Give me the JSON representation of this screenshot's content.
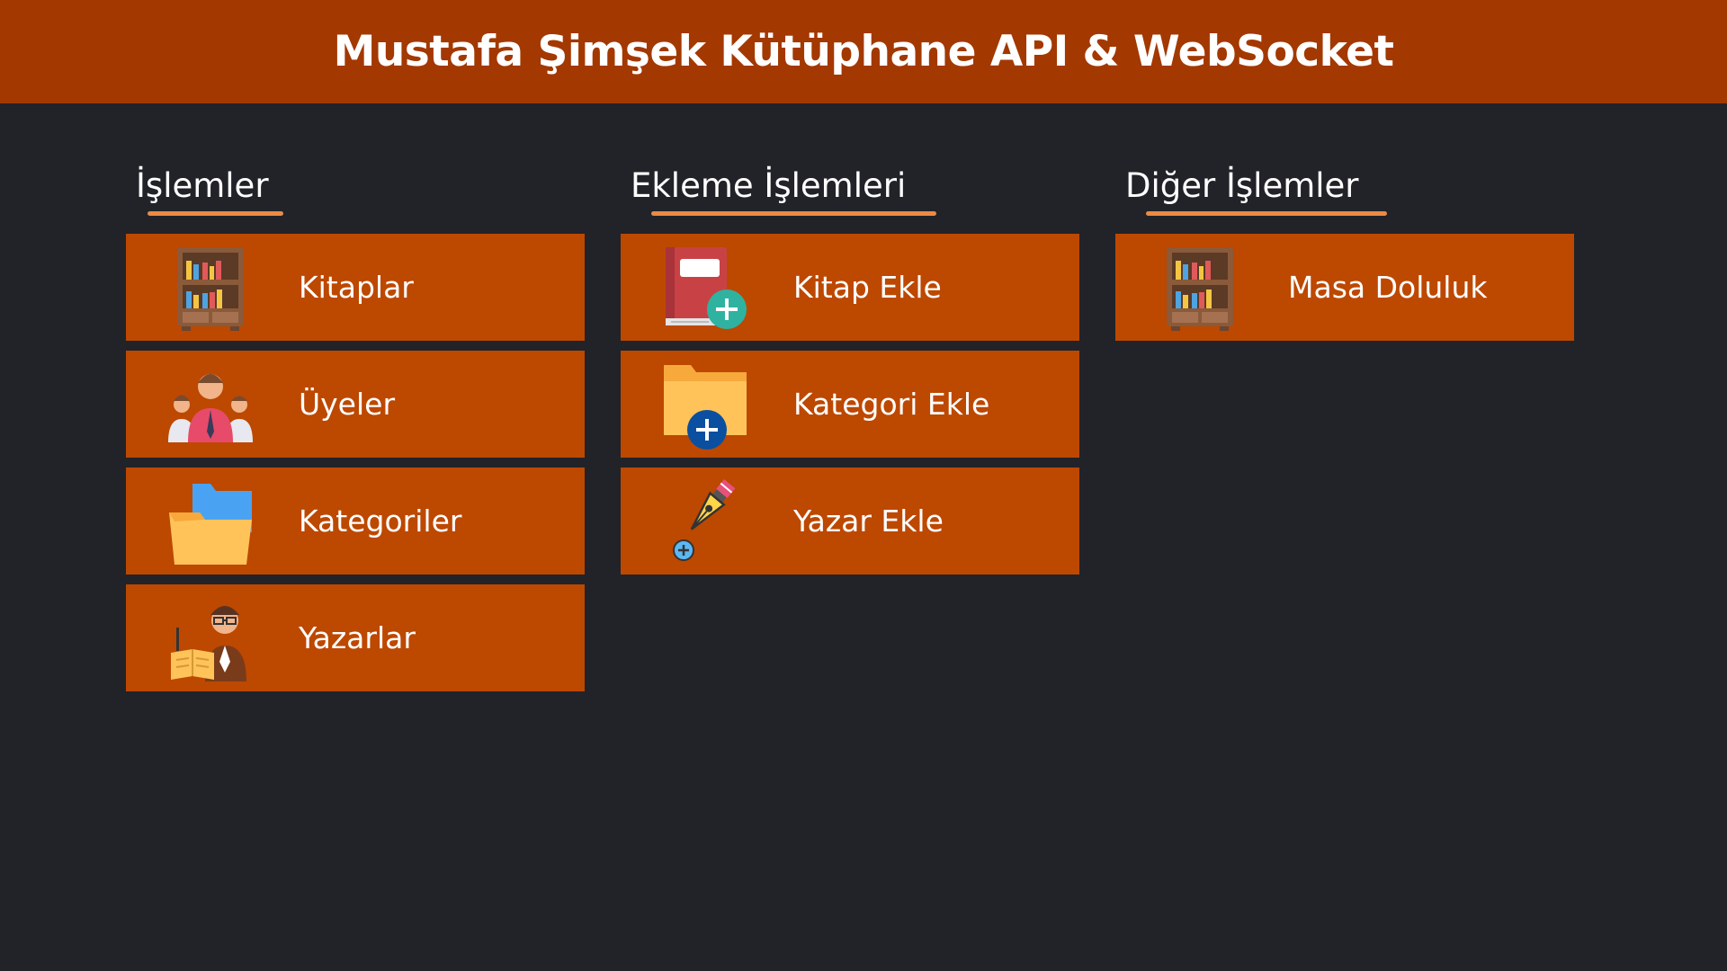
{
  "header": {
    "title": "Mustafa Şimşek Kütüphane API & WebSocket"
  },
  "colors": {
    "header_bg": "#a33800",
    "page_bg": "#212328",
    "card_bg": "#bd4800",
    "accent_underline": "#ec8a43"
  },
  "sections": [
    {
      "title": "İşlemler",
      "items": [
        {
          "label": "Kitaplar",
          "icon": "bookshelf-icon"
        },
        {
          "label": "Üyeler",
          "icon": "people-group-icon"
        },
        {
          "label": "Kategoriler",
          "icon": "folder-icon"
        },
        {
          "label": "Yazarlar",
          "icon": "author-reading-icon"
        }
      ]
    },
    {
      "title": "Ekleme İşlemleri",
      "items": [
        {
          "label": "Kitap Ekle",
          "icon": "book-add-icon"
        },
        {
          "label": "Kategori Ekle",
          "icon": "folder-add-icon"
        },
        {
          "label": "Yazar Ekle",
          "icon": "pen-add-icon"
        }
      ]
    },
    {
      "title": "Diğer İşlemler",
      "items": [
        {
          "label": "Masa Doluluk",
          "icon": "bookshelf-icon"
        }
      ]
    }
  ]
}
